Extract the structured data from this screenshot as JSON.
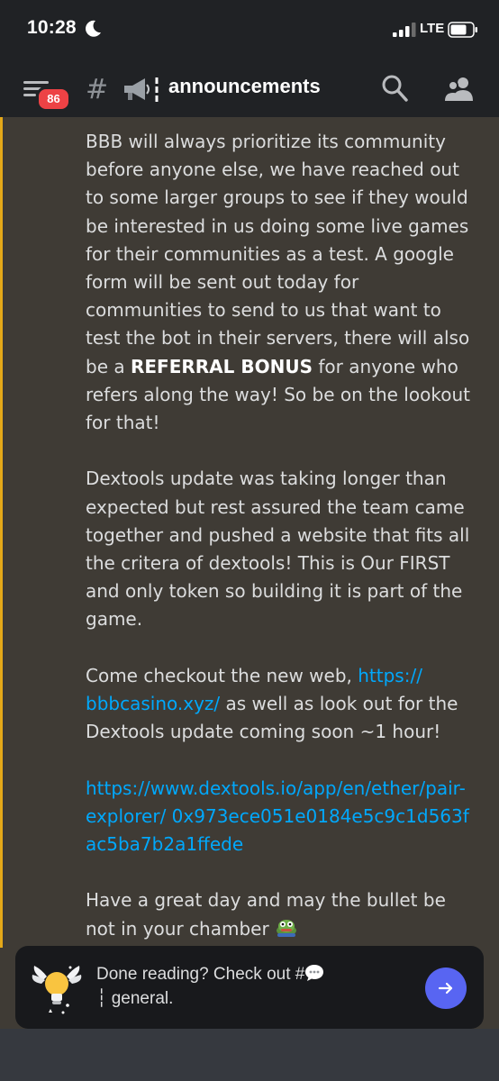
{
  "status_bar": {
    "time": "10:28",
    "network": "LTE"
  },
  "header": {
    "unread_badge": "86",
    "channel_name": "announcements"
  },
  "message": {
    "p1_text_before_bold": "BBB will always prioritize its community before anyone else, we have reached out to some larger groups to see if they would be interested in us doing some  live games for their communities as a test. A google form will be sent out today for communities to send to us that want to test the bot in their servers, there will also be a ",
    "p1_bold": "REFERRAL BONUS",
    "p1_text_after_bold": " for anyone who refers along the way! So be on the lookout for that!",
    "p2_text": "Dextools update was taking longer than expected but rest assured the team came together and pushed a website that fits all the critera of dextools! This is Our FIRST and only token so building it is part of the game.",
    "p3_text_before_link": "Come checkout the new web, ",
    "p3_link": "https:// bbbcasino.xyz/",
    "p3_text_after_link": " as well as look out for the Dextools update coming soon ~1 hour!",
    "p4_link": "https://www.dextools.io/app/en/ether/pair-explorer/ 0x973ece051e0184e5c9c1d563fac5ba7b2a1ffede",
    "p5_text": "Have a great day and may the bullet be not in your chamber"
  },
  "popup": {
    "text_line1": "Done reading? Check out #",
    "text_line2": "┆ general."
  },
  "colors": {
    "accent": "#5865f2",
    "link": "#00a8fc",
    "mention_bar": "#e4a819",
    "badge": "#ed4245"
  }
}
